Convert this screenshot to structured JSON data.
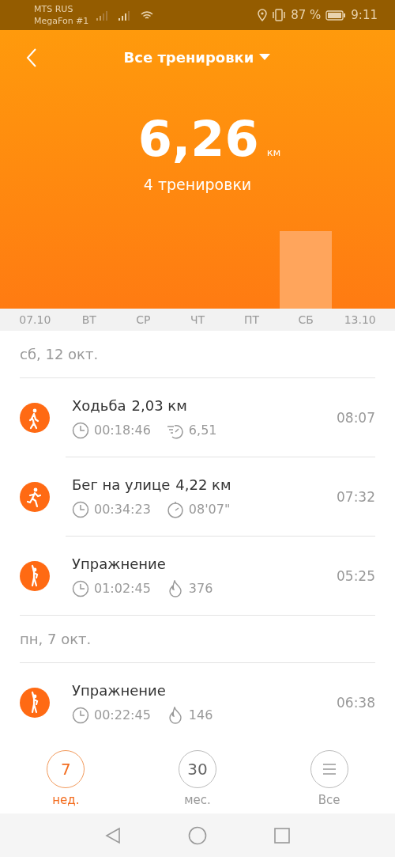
{
  "status_bar": {
    "carrier_1": "MTS RUS",
    "carrier_2": "MegaFon #1",
    "battery": "87 %",
    "time": "9:11"
  },
  "header": {
    "title": "Все тренировки",
    "total": "6,26",
    "unit": "км",
    "subtitle": "4 тренировки"
  },
  "days": [
    {
      "label": "07.10",
      "bar": false
    },
    {
      "label": "ВТ",
      "bar": false
    },
    {
      "label": "СР",
      "bar": false
    },
    {
      "label": "ЧТ",
      "bar": false
    },
    {
      "label": "ПТ",
      "bar": false
    },
    {
      "label": "СБ",
      "bar": true
    },
    {
      "label": "13.10",
      "bar": false
    }
  ],
  "sections": [
    {
      "date": "сб, 12 окт.",
      "workouts": [
        {
          "kind": "walk",
          "title": "Ходьба",
          "distance": "2,03 км",
          "time": "08:07",
          "stats": [
            {
              "kind": "duration",
              "value": "00:18:46"
            },
            {
              "kind": "cadence",
              "value": "6,51"
            }
          ]
        },
        {
          "kind": "run",
          "title": "Бег на улице",
          "distance": "4,22 км",
          "time": "07:32",
          "stats": [
            {
              "kind": "duration",
              "value": "00:34:23"
            },
            {
              "kind": "pace",
              "value": "08'07\""
            }
          ]
        },
        {
          "kind": "exercise",
          "title": "Упражнение",
          "time": "05:25",
          "stats": [
            {
              "kind": "duration",
              "value": "01:02:45"
            },
            {
              "kind": "calories",
              "value": "376"
            }
          ]
        }
      ]
    },
    {
      "date": "пн, 7 окт.",
      "workouts": [
        {
          "kind": "exercise",
          "title": "Упражнение",
          "time": "06:38",
          "stats": [
            {
              "kind": "duration",
              "value": "00:22:45"
            },
            {
              "kind": "calories",
              "value": "146"
            }
          ]
        }
      ]
    }
  ],
  "periods": [
    {
      "kind": "number",
      "value": "7",
      "label": "нед.",
      "selected": true
    },
    {
      "kind": "number",
      "value": "30",
      "label": "мес.",
      "selected": false
    },
    {
      "kind": "menu",
      "label": "Все",
      "selected": false
    }
  ]
}
